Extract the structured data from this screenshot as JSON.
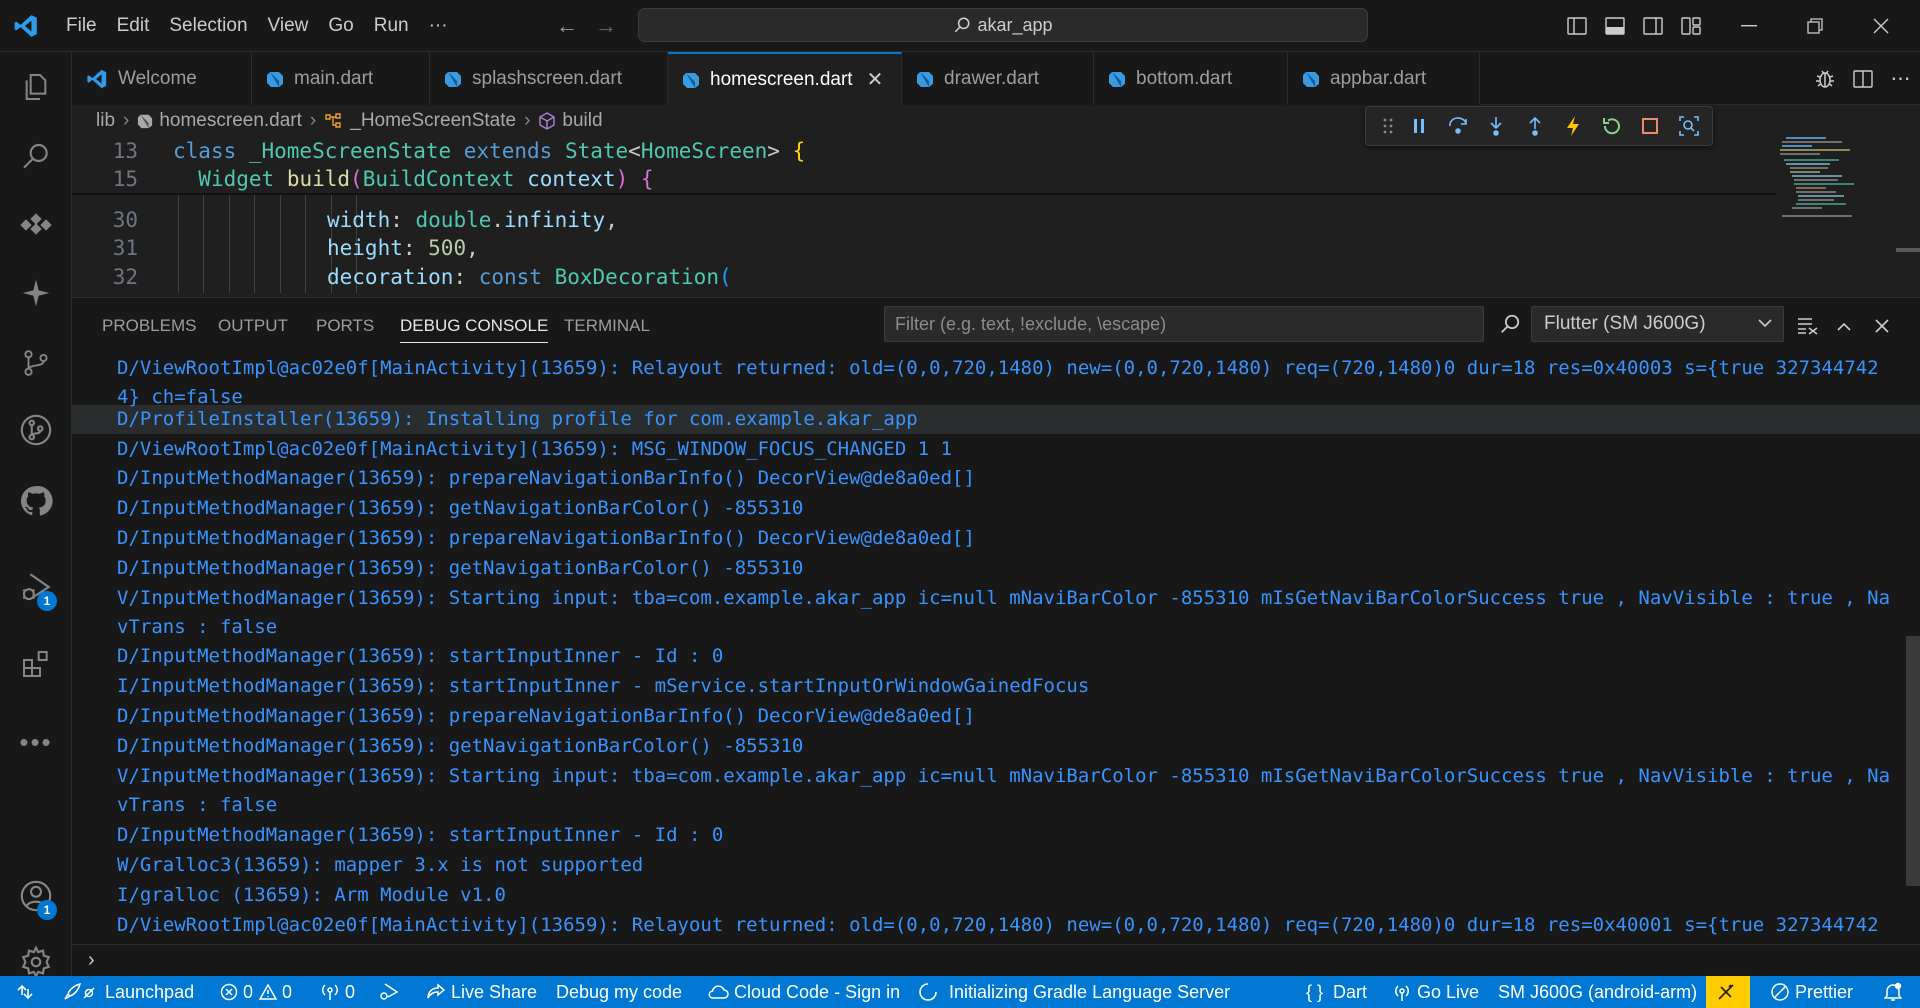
{
  "menu": [
    "File",
    "Edit",
    "Selection",
    "View",
    "Go",
    "Run",
    "···"
  ],
  "search": {
    "label": "akar_app"
  },
  "colors": {
    "accent": "#0078d4",
    "log_text": "#3794ff",
    "dart": "#3fa9f5"
  },
  "tabs": [
    {
      "label": "Welcome",
      "icon": "vscode-icon"
    },
    {
      "label": "main.dart",
      "icon": "dart-icon"
    },
    {
      "label": "splashscreen.dart",
      "icon": "dart-icon"
    },
    {
      "label": "homescreen.dart",
      "icon": "dart-icon",
      "active": true
    },
    {
      "label": "drawer.dart",
      "icon": "dart-icon"
    },
    {
      "label": "bottom.dart",
      "icon": "dart-icon"
    },
    {
      "label": "appbar.dart",
      "icon": "dart-icon"
    }
  ],
  "breadcrumb": {
    "folder": "lib",
    "file": "homescreen.dart",
    "class": "_HomeScreenState",
    "method": "build"
  },
  "code": {
    "ln13": "13",
    "ln15": "15",
    "ln30": "30",
    "ln31": "31",
    "ln32": "32",
    "l13": {
      "a": "class ",
      "b": "_HomeScreenState",
      "c": " extends ",
      "d": "State",
      "e": "<",
      "f": "HomeScreen",
      "g": "> ",
      "h": "{"
    },
    "l15": {
      "a": "  ",
      "b": "Widget",
      "c": " ",
      "d": "build",
      "e": "(",
      "f": "BuildContext",
      "g": " ",
      "h": "context",
      "i": ") ",
      "j": "{"
    },
    "l30": {
      "a": "width",
      "b": ": ",
      "c": "double",
      "d": ".",
      "e": "infinity",
      "f": ","
    },
    "l31": {
      "a": "height",
      "b": ": ",
      "c": "500",
      "d": ","
    },
    "l32": {
      "a": "decoration",
      "b": ": ",
      "c": "const",
      "d": " ",
      "e": "BoxDecoration",
      "f": "("
    }
  },
  "panel": {
    "tabs": [
      "PROBLEMS",
      "OUTPUT",
      "PORTS",
      "DEBUG CONSOLE",
      "TERMINAL"
    ],
    "active_tab": "DEBUG CONSOLE",
    "filter_placeholder": "Filter (e.g. text, !exclude, \\escape)",
    "session": "Flutter (SM J600G)"
  },
  "console_lines": [
    "D/ViewRootImpl@ac02e0f[MainActivity](13659): Relayout returned: old=(0,0,720,1480) new=(0,0,720,1480) req=(720,1480)0 dur=18 res=0x40003 s={true 327344742",
    "4} ch=false",
    "D/ProfileInstaller(13659): Installing profile for com.example.akar_app",
    "D/ViewRootImpl@ac02e0f[MainActivity](13659): MSG_WINDOW_FOCUS_CHANGED 1 1",
    "D/InputMethodManager(13659): prepareNavigationBarInfo() DecorView@de8a0ed[]",
    "D/InputMethodManager(13659): getNavigationBarColor() -855310",
    "D/InputMethodManager(13659): prepareNavigationBarInfo() DecorView@de8a0ed[]",
    "D/InputMethodManager(13659): getNavigationBarColor() -855310",
    "V/InputMethodManager(13659): Starting input: tba=com.example.akar_app ic=null mNaviBarColor -855310 mIsGetNaviBarColorSuccess true , NavVisible : true , Na",
    "vTrans : false",
    "D/InputMethodManager(13659): startInputInner - Id : 0",
    "I/InputMethodManager(13659): startInputInner - mService.startInputOrWindowGainedFocus",
    "D/InputMethodManager(13659): prepareNavigationBarInfo() DecorView@de8a0ed[]",
    "D/InputMethodManager(13659): getNavigationBarColor() -855310",
    "V/InputMethodManager(13659): Starting input: tba=com.example.akar_app ic=null mNaviBarColor -855310 mIsGetNaviBarColorSuccess true , NavVisible : true , Na",
    "vTrans : false",
    "D/InputMethodManager(13659): startInputInner - Id : 0",
    "W/Gralloc3(13659): mapper 3.x is not supported",
    "I/gralloc (13659): Arm Module v1.0",
    "D/ViewRootImpl@ac02e0f[MainActivity](13659): Relayout returned: old=(0,0,720,1480) new=(0,0,720,1480) req=(720,1480)0 dur=18 res=0x40001 s={true 327344742"
  ],
  "activity_badges": {
    "run": "1",
    "accounts": "1"
  },
  "status": {
    "launchpad": "Launchpad",
    "errors": "0",
    "warnings": "0",
    "ports": "0",
    "live_share": "Live Share",
    "debug_my_code": "Debug my code",
    "cloud_code": "Cloud Code - Sign in",
    "gradle": "Initializing Gradle Language Server",
    "language": "Dart",
    "go_live": "Go Live",
    "device": "SM J600G (android-arm)",
    "prettier": "Prettier"
  }
}
